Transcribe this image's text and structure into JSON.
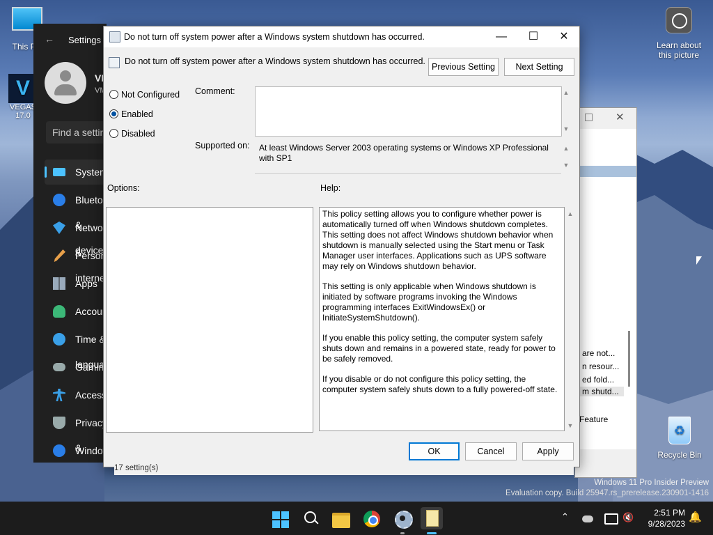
{
  "desktop": {
    "icons": {
      "this_pc": "This PC",
      "vegas": "VEGAS",
      "vegas_ver": "17.0",
      "learn_about": "Learn about this picture",
      "recycle_bin": "Recycle Bin"
    },
    "watermark": {
      "line1": "Windows 11 Pro Insider Preview",
      "line2": "Evaluation copy. Build 25947.rs_prerelease.230901-1416"
    }
  },
  "settings": {
    "title": "Settings",
    "user_initials": "VM",
    "user_sub": "VM",
    "search_placeholder": "Find a setting",
    "nav": [
      {
        "label": "System"
      },
      {
        "label": "Bluetooth & devices"
      },
      {
        "label": "Network & internet"
      },
      {
        "label": "Personalization"
      },
      {
        "label": "Apps"
      },
      {
        "label": "Accounts"
      },
      {
        "label": "Time & language"
      },
      {
        "label": "Gaming"
      },
      {
        "label": "Accessibility"
      },
      {
        "label": "Privacy & security"
      },
      {
        "label": "Windows Update"
      }
    ]
  },
  "gp_background": {
    "items": [
      "are not...",
      "n resour...",
      "ed fold...",
      "m shutd..."
    ],
    "feature": "Feature",
    "status": "17 setting(s)"
  },
  "dialog": {
    "title": "Do not turn off system power after a Windows system shutdown has occurred.",
    "policy_name": "Do not turn off system power after a Windows system shutdown has occurred.",
    "prev_button": "Previous Setting",
    "next_button": "Next Setting",
    "radios": {
      "not_configured": "Not Configured",
      "enabled": "Enabled",
      "disabled": "Disabled",
      "selected": "enabled"
    },
    "comment_label": "Comment:",
    "comment_value": "",
    "supported_label": "Supported on:",
    "supported_value": "At least Windows Server 2003 operating systems or Windows XP Professional with SP1",
    "options_label": "Options:",
    "help_label": "Help:",
    "help_paragraphs": [
      "This policy setting allows you to configure whether power is automatically turned off when Windows shutdown completes. This setting does not affect Windows shutdown behavior when shutdown is manually selected using the Start menu or Task Manager user interfaces.  Applications such as UPS software may rely on Windows shutdown behavior.",
      "This setting is only applicable when Windows shutdown is initiated by software programs invoking the Windows programming interfaces ExitWindowsEx() or InitiateSystemShutdown().",
      "If you enable this policy setting, the computer system safely shuts down and remains in a powered state, ready for power to be safely removed.",
      "If you disable or do not configure this policy setting, the computer system safely shuts down to a fully powered-off state."
    ],
    "ok_button": "OK",
    "cancel_button": "Cancel",
    "apply_button": "Apply"
  },
  "taskbar": {
    "time": "2:51 PM",
    "date": "9/28/2023"
  },
  "colors": {
    "accent": "#0078d4",
    "taskbar_bg": "#1c1c1c",
    "settings_bg": "#202020"
  }
}
